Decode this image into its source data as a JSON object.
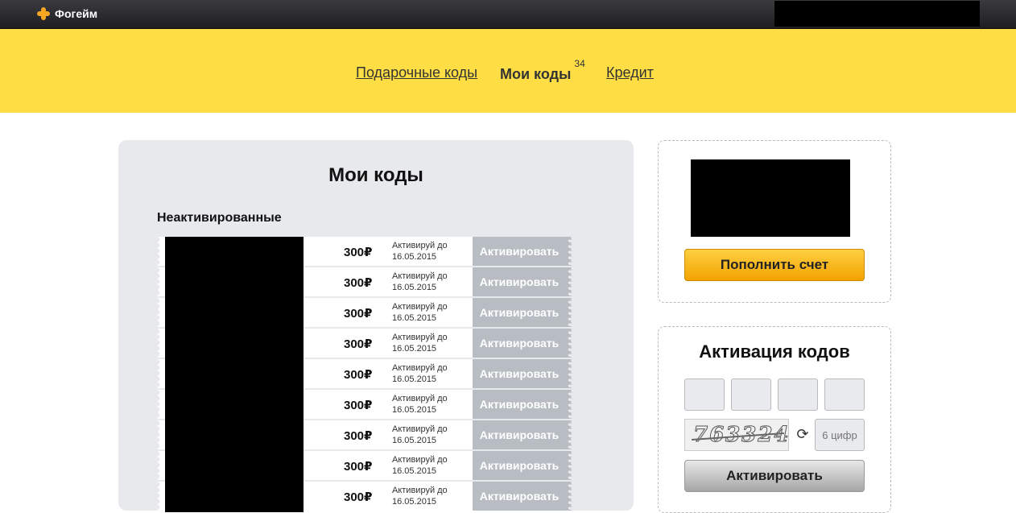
{
  "header": {
    "logo_label": "Фогейм"
  },
  "nav": {
    "gift_codes": "Подарочные коды",
    "my_codes": "Мои коды",
    "my_codes_count": "34",
    "credit": "Кредит"
  },
  "main": {
    "title": "Мои коды",
    "section_title": "Неактивированные",
    "codes": [
      {
        "amount": "300",
        "currency": "₽",
        "until_label": "Активируй до",
        "until_date": "16.05.2015",
        "button": "Активировать"
      },
      {
        "amount": "300",
        "currency": "₽",
        "until_label": "Активируй до",
        "until_date": "16.05.2015",
        "button": "Активировать"
      },
      {
        "amount": "300",
        "currency": "₽",
        "until_label": "Активируй до",
        "until_date": "16.05.2015",
        "button": "Активировать"
      },
      {
        "amount": "300",
        "currency": "₽",
        "until_label": "Активируй до",
        "until_date": "16.05.2015",
        "button": "Активировать"
      },
      {
        "amount": "300",
        "currency": "₽",
        "until_label": "Активируй до",
        "until_date": "16.05.2015",
        "button": "Активировать"
      },
      {
        "amount": "300",
        "currency": "₽",
        "until_label": "Активируй до",
        "until_date": "16.05.2015",
        "button": "Активировать"
      },
      {
        "amount": "300",
        "currency": "₽",
        "until_label": "Активируй до",
        "until_date": "16.05.2015",
        "button": "Активировать"
      },
      {
        "amount": "300",
        "currency": "₽",
        "until_label": "Активируй до",
        "until_date": "16.05.2015",
        "button": "Активировать"
      },
      {
        "amount": "300",
        "currency": "₽",
        "until_label": "Активируй до",
        "until_date": "16.05.2015",
        "button": "Активировать"
      }
    ]
  },
  "balance_box": {
    "topup_button": "Пополнить счет"
  },
  "activation_box": {
    "title": "Активация кодов",
    "captcha_text": "763324",
    "captcha_placeholder": "6 цифр",
    "activate_button": "Активировать"
  },
  "colors": {
    "brand_yellow": "#ffde45",
    "topbar_dark": "#2a2a2e",
    "activate_gray": "#b8bdc3",
    "topup_orange": "#f5b800"
  }
}
